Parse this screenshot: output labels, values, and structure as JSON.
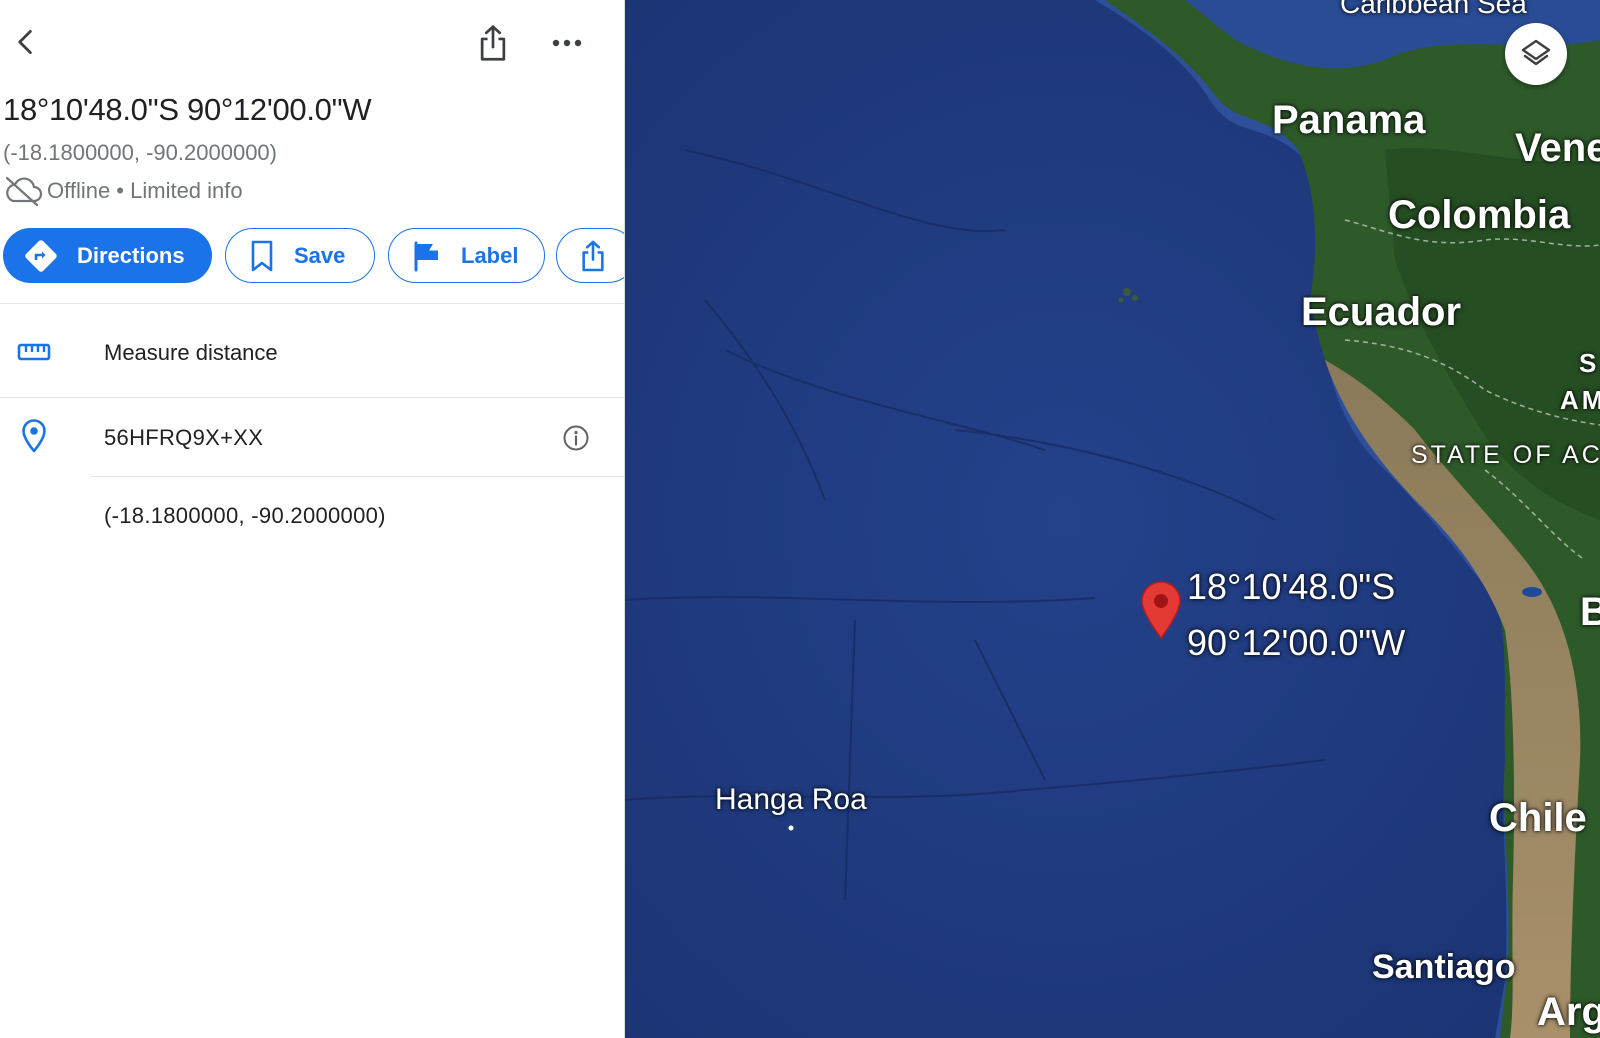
{
  "place": {
    "title": "18°10'48.0\"S 90°12'00.0\"W",
    "decimal_coords": "(-18.1800000, -90.2000000)",
    "status_offline": "Offline",
    "status_separator": " • ",
    "status_info": "Limited info"
  },
  "actions": {
    "directions": "Directions",
    "save": "Save",
    "label": "Label"
  },
  "details": {
    "measure_distance": "Measure distance",
    "plus_code": "56HFRQ9X+XX",
    "coordinates": "(-18.1800000, -90.2000000)"
  },
  "map": {
    "labels": {
      "caribbean_sea": "Caribbean Sea",
      "panama": "Panama",
      "venezuela": "Vene",
      "colombia": "Colombia",
      "ecuador": "Ecuador",
      "south_america_1": "S",
      "south_america_2": "AM",
      "state_of_acre": "STATE OF AC",
      "bolivia": "B",
      "chile": "Chile",
      "hanga_roa": "Hanga Roa",
      "santiago": "Santiago",
      "argentina": "Arg"
    },
    "pin_label_line1": "18°10'48.0\"S",
    "pin_label_line2": "90°12'00.0\"W"
  },
  "icons": {
    "back": "chevron-left-icon",
    "share": "share-icon",
    "more": "more-horiz-icon",
    "cloud_offline": "cloud-off-icon",
    "directions": "directions-diamond-icon",
    "bookmark": "bookmark-icon",
    "flag": "flag-icon",
    "ruler": "ruler-icon",
    "location": "location-pin-icon",
    "info": "info-icon",
    "layers": "layers-icon",
    "map_pin": "red-map-pin-icon"
  },
  "colors": {
    "accent": "#1a73e8",
    "ocean": "#233e84",
    "land": "#2f5a2c",
    "pin": "#e53935"
  }
}
